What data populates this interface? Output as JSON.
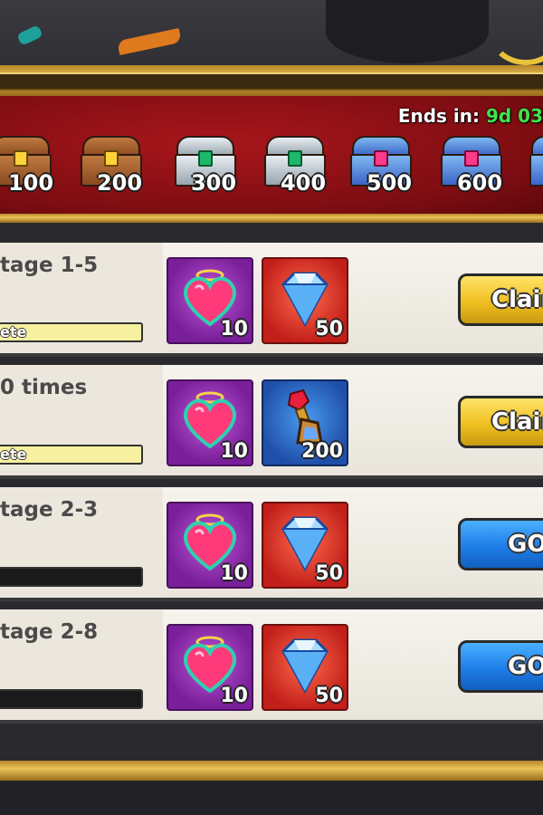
{
  "event": {
    "ends_label": "Ends in:",
    "ends_time": "9d 03"
  },
  "milestones": [
    {
      "label": "100",
      "chest": "wood-chest"
    },
    {
      "label": "200",
      "chest": "wood-chest"
    },
    {
      "label": "300",
      "chest": "silver-chest"
    },
    {
      "label": "400",
      "chest": "silver-chest"
    },
    {
      "label": "500",
      "chest": "jewel-chest"
    },
    {
      "label": "600",
      "chest": "jewel-chest"
    }
  ],
  "quests": [
    {
      "title": "tage 1-5",
      "progress_text": "ete",
      "progress": 1.0,
      "rewards": [
        {
          "icon": "heart-gem-icon",
          "qty": "10"
        },
        {
          "icon": "diamond-icon",
          "qty": "50"
        }
      ],
      "button": "Claim",
      "button_type": "claim"
    },
    {
      "title": "0 times",
      "progress_text": "ete",
      "progress": 1.0,
      "rewards": [
        {
          "icon": "heart-gem-icon",
          "qty": "10"
        },
        {
          "icon": "ruby-key-icon",
          "qty": "200"
        }
      ],
      "button": "Claim",
      "button_type": "claim"
    },
    {
      "title": "tage 2-3",
      "progress_text": "",
      "progress": 0.0,
      "rewards": [
        {
          "icon": "heart-gem-icon",
          "qty": "10"
        },
        {
          "icon": "diamond-icon",
          "qty": "50"
        }
      ],
      "button": "GO",
      "button_type": "go"
    },
    {
      "title": "tage 2-8",
      "progress_text": "",
      "progress": 0.0,
      "rewards": [
        {
          "icon": "heart-gem-icon",
          "qty": "10"
        },
        {
          "icon": "diamond-icon",
          "qty": "50"
        }
      ],
      "button": "GO",
      "button_type": "go"
    }
  ]
}
